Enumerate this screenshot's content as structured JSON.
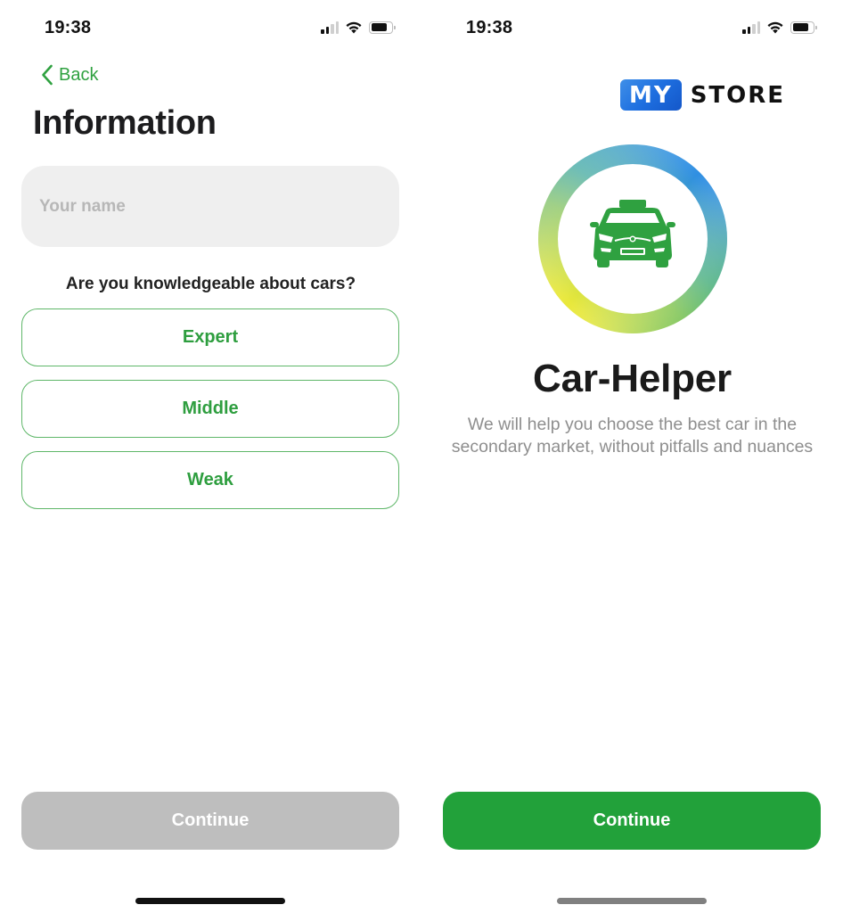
{
  "left_screen": {
    "status_bar": {
      "time": "19:38"
    },
    "nav": {
      "back_label": "Back"
    },
    "title": "Information",
    "name_field": {
      "value": "",
      "placeholder": "Your name"
    },
    "question": "Are you knowledgeable about cars?",
    "options": [
      {
        "label": "Expert"
      },
      {
        "label": "Middle"
      },
      {
        "label": "Weak"
      }
    ],
    "continue_button": {
      "label": "Continue",
      "state": "disabled"
    }
  },
  "right_screen": {
    "status_bar": {
      "time": "19:38"
    },
    "brand": {
      "part1": "MY",
      "part2": "STORE"
    },
    "app_icon": "taxi-car-icon",
    "app_name": "Car-Helper",
    "description": "We will help you choose the best car in the secondary market, without pitfalls and nuances",
    "continue_button": {
      "label": "Continue",
      "state": "enabled"
    }
  },
  "colors": {
    "accent_green": "#22a13a",
    "option_border": "#5fb769",
    "disabled_gray": "#bebebe",
    "input_bg": "#efefef",
    "ring_gradient": [
      "#e8e83a",
      "#8cc65a",
      "#3aa0e0",
      "#2e8fe0"
    ]
  }
}
